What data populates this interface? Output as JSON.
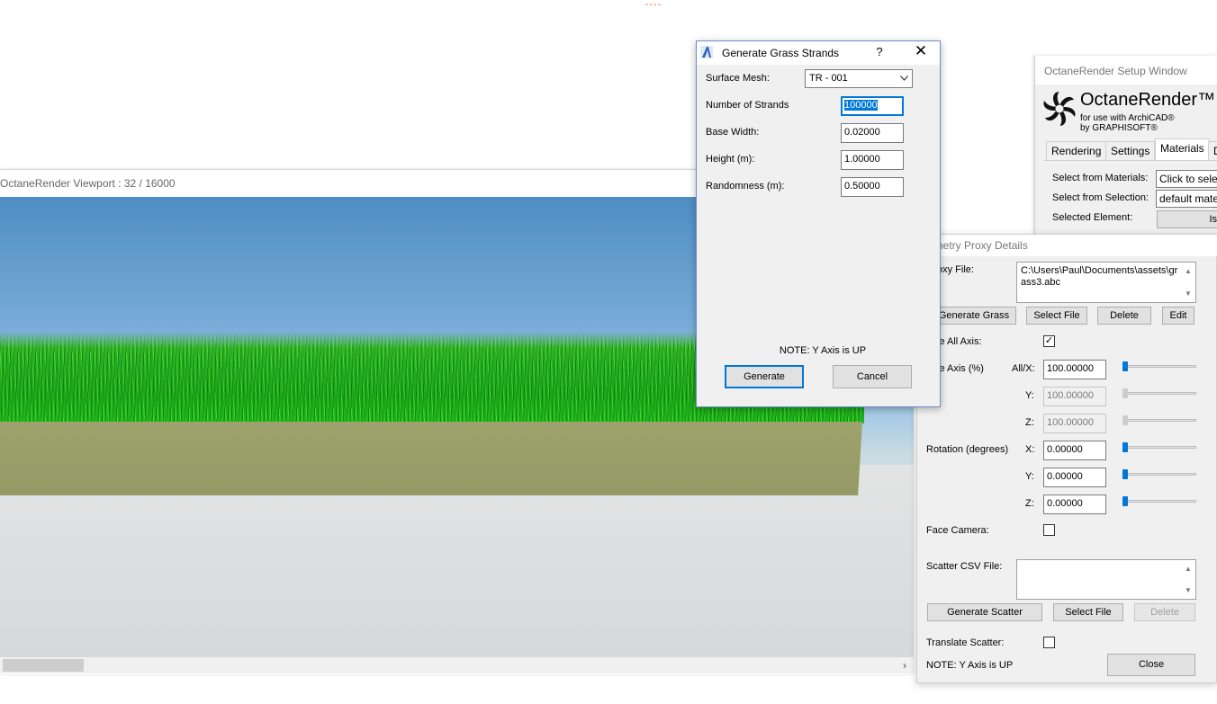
{
  "viewport": {
    "title": "OctaneRender Viewport : 32  / 16000",
    "scroll_right_icon": "chevron-right-icon"
  },
  "grass_dialog": {
    "title": "Generate Grass Strands",
    "help": "?",
    "close": "✕",
    "surface_mesh_label": "Surface Mesh:",
    "surface_mesh_value": "TR - 001",
    "strands_label": "Number of Strands",
    "strands_value": "100000",
    "base_width_label": "Base Width:",
    "base_width_value": "0.02000",
    "height_label": "Height (m):",
    "height_value": "1.00000",
    "randomness_label": "Randomness (m):",
    "randomness_value": "0.50000",
    "note": "NOTE: Y Axis is UP",
    "generate_label": "Generate",
    "cancel_label": "Cancel"
  },
  "setup_window": {
    "title": "OctaneRender Setup Window",
    "brand": "OctaneRender™",
    "sub1": "for use with ArchiCAD®",
    "sub2": "by GRAPHISOFT®",
    "tabs": [
      "Rendering",
      "Settings",
      "Materials",
      "D"
    ],
    "active_tab": "Materials",
    "select_materials_label": "Select from Materials:",
    "select_materials_value": "Click to selec",
    "select_selection_label": "Select from Selection:",
    "select_selection_value": "default mate",
    "selected_element_label": "Selected Element:",
    "selected_element_value": "Is"
  },
  "proxy_window": {
    "title": "ometry Proxy Details",
    "proxy_file_label": "oxy File:",
    "proxy_file_value": "C:\\Users\\Paul\\Documents\\assets\\grass3.abc",
    "generate_grass_label": "Generate Grass",
    "select_file_label": "Select File",
    "delete_label": "Delete",
    "edit_label": "Edit",
    "scale_all_axis_label": "le All Axis:",
    "scale_all_axis_checked": true,
    "scale_axis_label": "le Axis (%)",
    "allx_label": "All/X:",
    "allx_value": "100.00000",
    "y_label": "Y:",
    "y_value": "100.00000",
    "z_label": "Z:",
    "z_value": "100.00000",
    "rotation_label": "Rotation (degrees)",
    "rot_x_label": "X:",
    "rot_x_value": "0.00000",
    "rot_y_label": "Y:",
    "rot_y_value": "0.00000",
    "rot_z_label": "Z:",
    "rot_z_value": "0.00000",
    "face_camera_label": "Face Camera:",
    "face_camera_checked": false,
    "scatter_csv_label": "Scatter CSV File:",
    "scatter_csv_value": "",
    "generate_scatter_label": "Generate Scatter",
    "select_file2_label": "Select File",
    "delete2_label": "Delete",
    "translate_scatter_label": "Translate Scatter:",
    "translate_scatter_checked": false,
    "note": "NOTE: Y Axis is UP",
    "close_label": "Close"
  }
}
